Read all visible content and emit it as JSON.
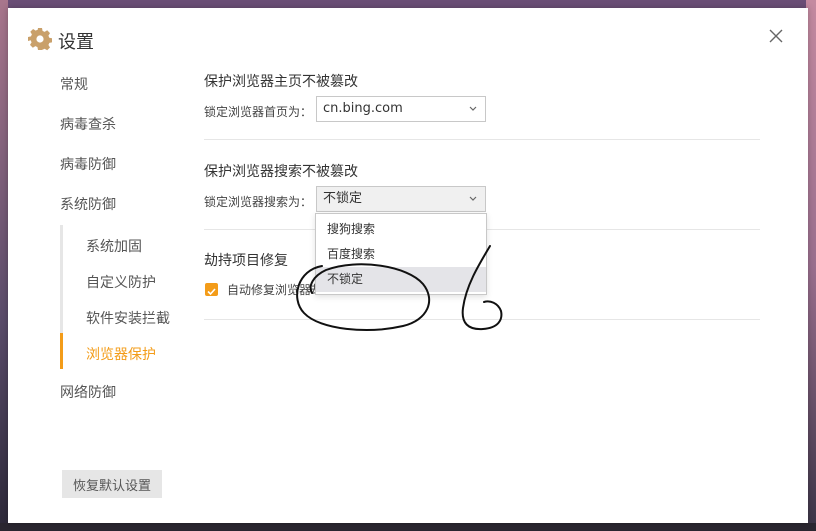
{
  "window": {
    "title": "设置"
  },
  "sidebar": {
    "items": [
      {
        "label": "常规"
      },
      {
        "label": "病毒查杀"
      },
      {
        "label": "病毒防御"
      },
      {
        "label": "系统防御"
      },
      {
        "label": "网络防御"
      }
    ],
    "sub_items": [
      {
        "label": "系统加固"
      },
      {
        "label": "自定义防护"
      },
      {
        "label": "软件安装拦截"
      },
      {
        "label": "浏览器保护",
        "active": true
      }
    ],
    "restore_label": "恢复默认设置"
  },
  "homepage_section": {
    "title": "保护浏览器主页不被篡改",
    "field_label": "锁定浏览器首页为：",
    "selected_value": "cn.bing.com"
  },
  "search_section": {
    "title": "保护浏览器搜索不被篡改",
    "field_label": "锁定浏览器搜索为：",
    "selected_value": "不锁定",
    "options": [
      {
        "label": "搜狗搜索"
      },
      {
        "label": "百度搜索"
      },
      {
        "label": "不锁定"
      }
    ]
  },
  "hijack_section": {
    "title": "劫持项目修复",
    "checkbox_label": "自动修复浏览器劫",
    "checked": true
  },
  "colors": {
    "accent": "#f39c19",
    "text": "#333333",
    "divider": "#e6e6e6"
  },
  "icons": {
    "title": "gear-icon",
    "close": "close-icon",
    "chevron": "chevron-down-icon",
    "check": "check-icon"
  }
}
